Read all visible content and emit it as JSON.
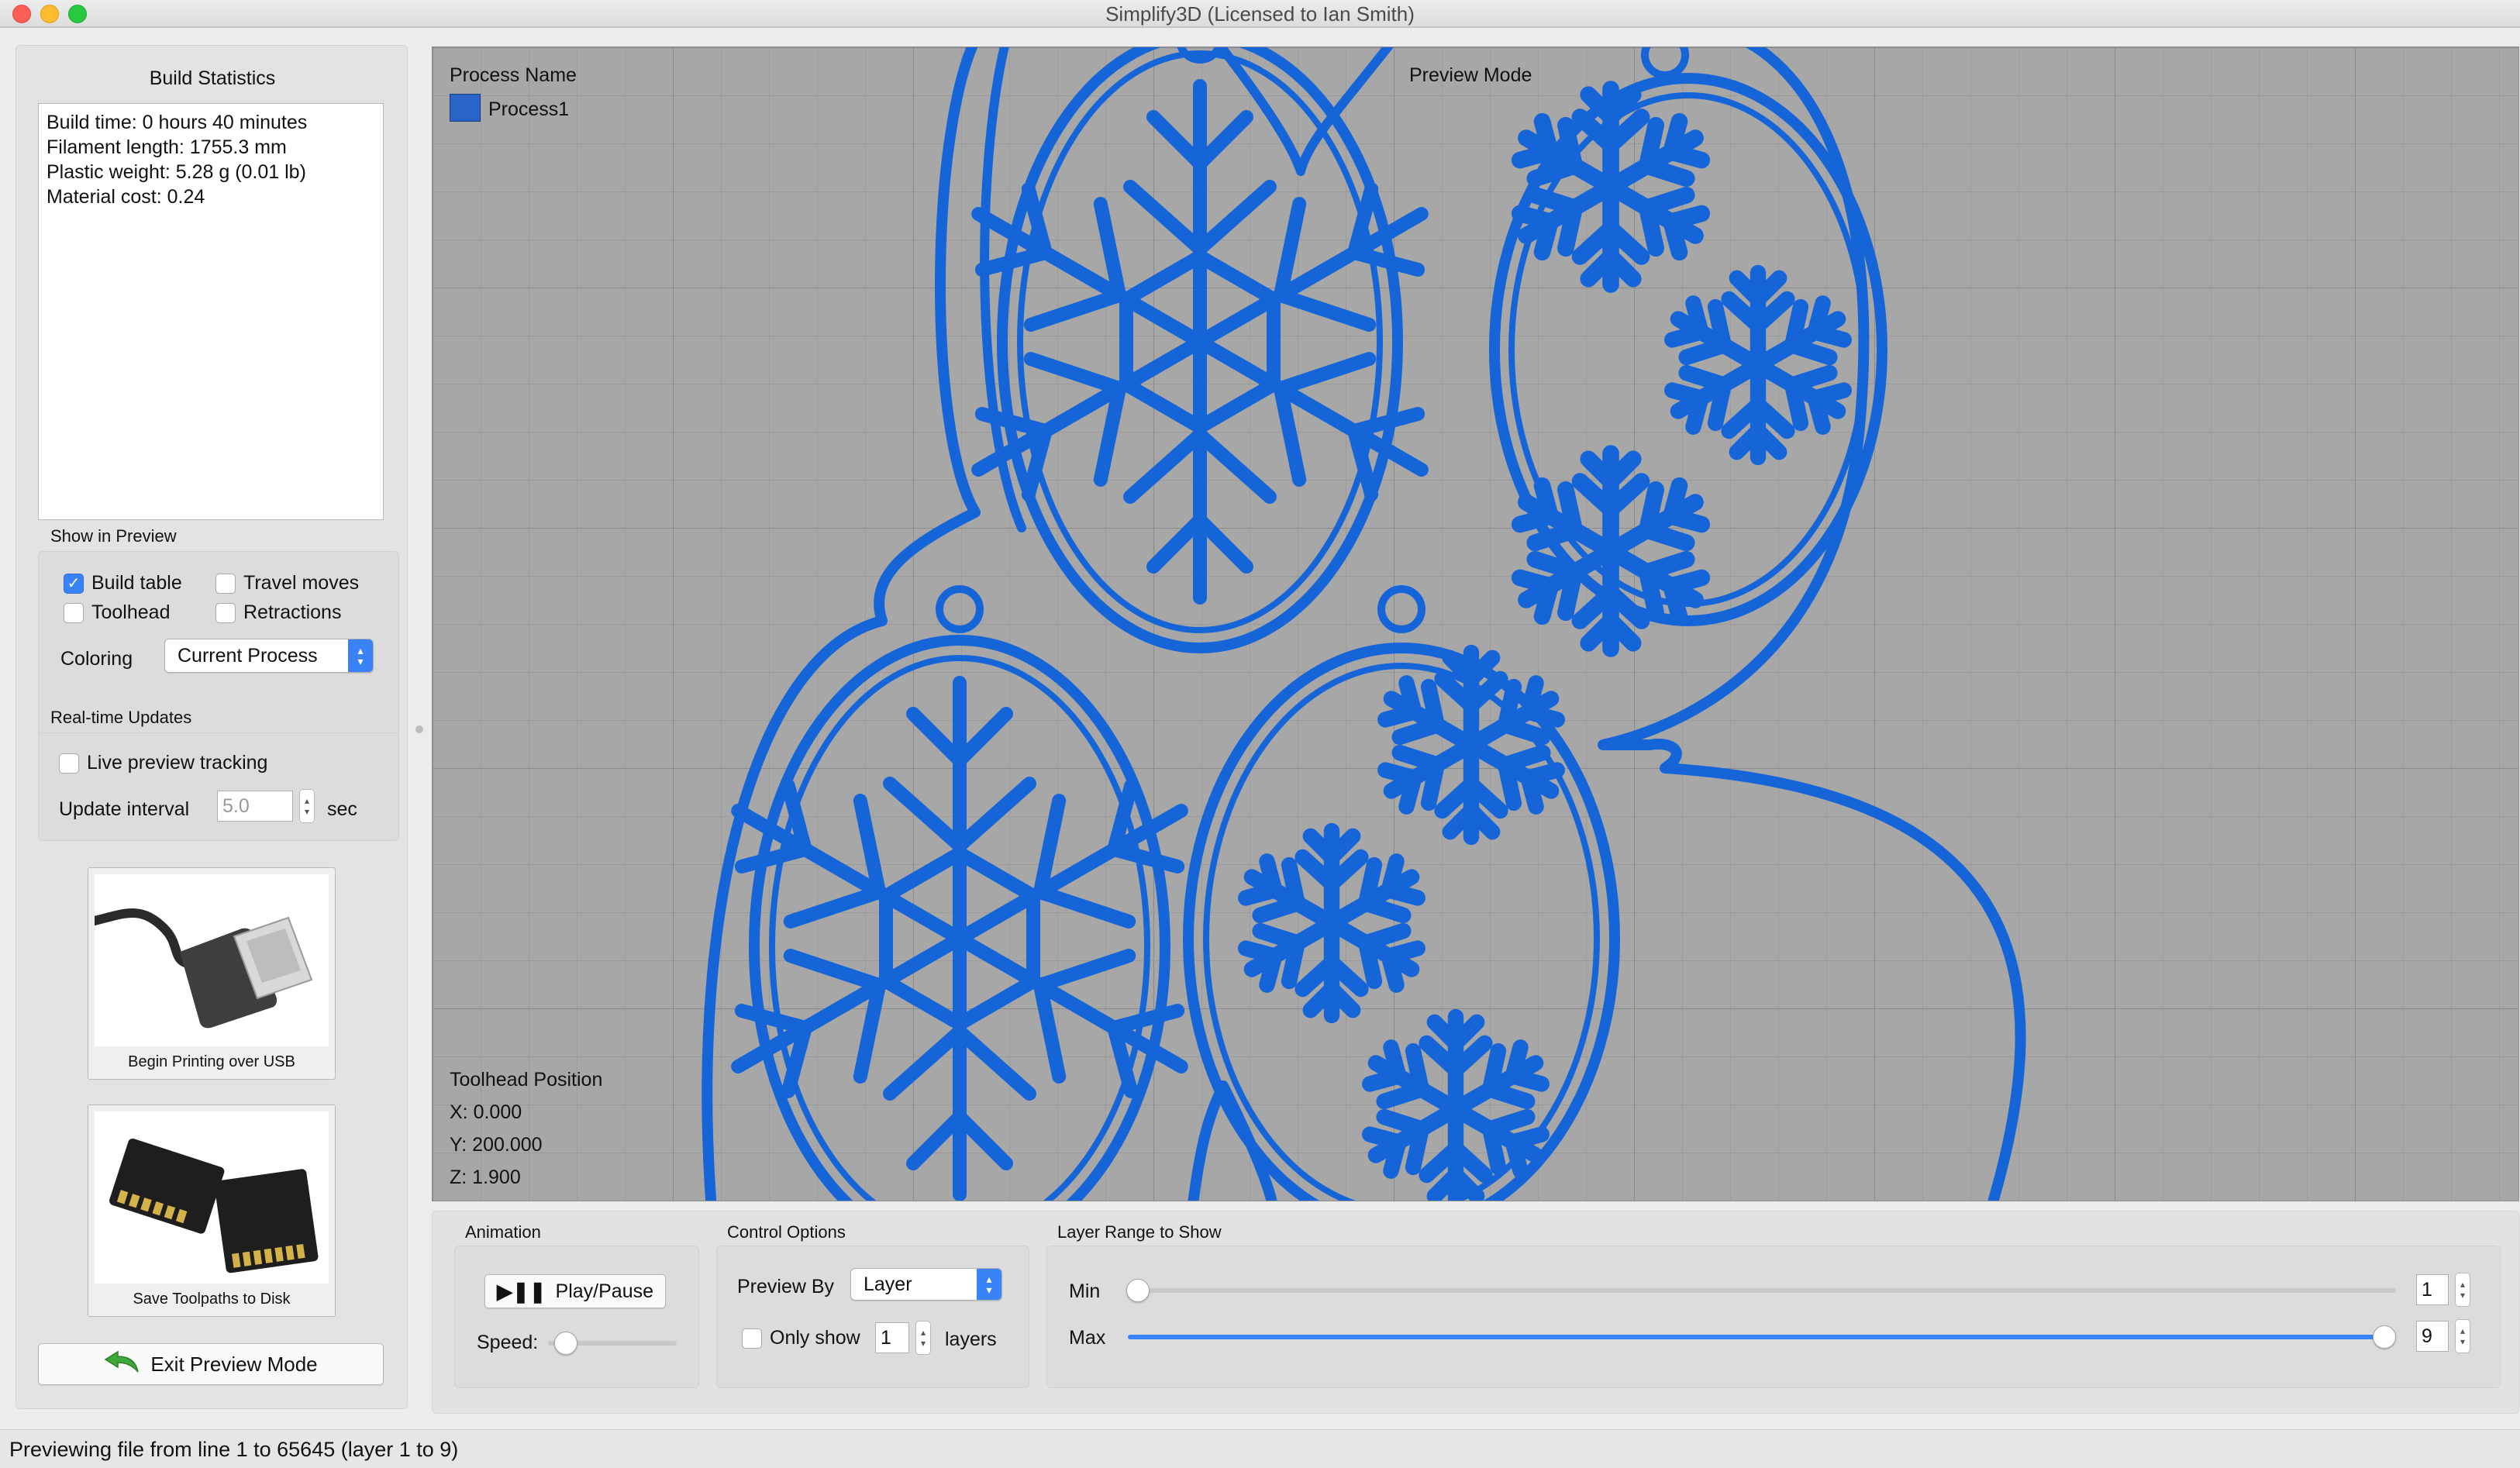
{
  "window": {
    "title": "Simplify3D (Licensed to Ian Smith)"
  },
  "build_statistics": {
    "title": "Build Statistics",
    "lines": [
      "Build time: 0 hours 40 minutes",
      "Filament length: 1755.3 mm",
      "Plastic weight: 5.28 g (0.01 lb)",
      "Material cost: 0.24"
    ]
  },
  "show_in_preview": {
    "label": "Show in Preview",
    "build_table": {
      "label": "Build table",
      "checked": true
    },
    "travel_moves": {
      "label": "Travel moves",
      "checked": false
    },
    "toolhead": {
      "label": "Toolhead",
      "checked": false
    },
    "retractions": {
      "label": "Retractions",
      "checked": false
    },
    "coloring_label": "Coloring",
    "coloring_value": "Current Process"
  },
  "realtime_updates": {
    "label": "Real-time Updates",
    "live_tracking": {
      "label": "Live preview tracking",
      "checked": false
    },
    "update_interval_label": "Update interval",
    "update_interval_value": "5.0",
    "update_interval_unit": "sec"
  },
  "actions": {
    "usb_label": "Begin Printing over USB",
    "disk_label": "Save Toolpaths to Disk",
    "exit_label": "Exit Preview Mode"
  },
  "viewport": {
    "process_header": "Process Name",
    "process_name": "Process1",
    "process_color": "#2a64c8",
    "mode_label": "Preview Mode",
    "toolhead_header": "Toolhead Position",
    "x": "X: 0.000",
    "y": "Y: 200.000",
    "z": "Z: 1.900",
    "toolpath_color": "#1565d8"
  },
  "animation": {
    "label": "Animation",
    "play_label": "Play/Pause",
    "speed_label": "Speed:",
    "speed_level": 0.15
  },
  "control_options": {
    "label": "Control Options",
    "preview_by_label": "Preview By",
    "preview_by_value": "Layer",
    "only_show_label": "Only show",
    "only_show_value": "1",
    "layers_label": "layers"
  },
  "layer_range": {
    "label": "Layer Range to Show",
    "min_label": "Min",
    "min_value": "1",
    "max_label": "Max",
    "max_value": "9"
  },
  "status": {
    "text": "Previewing file from line 1 to 65645 (layer 1 to 9)"
  }
}
